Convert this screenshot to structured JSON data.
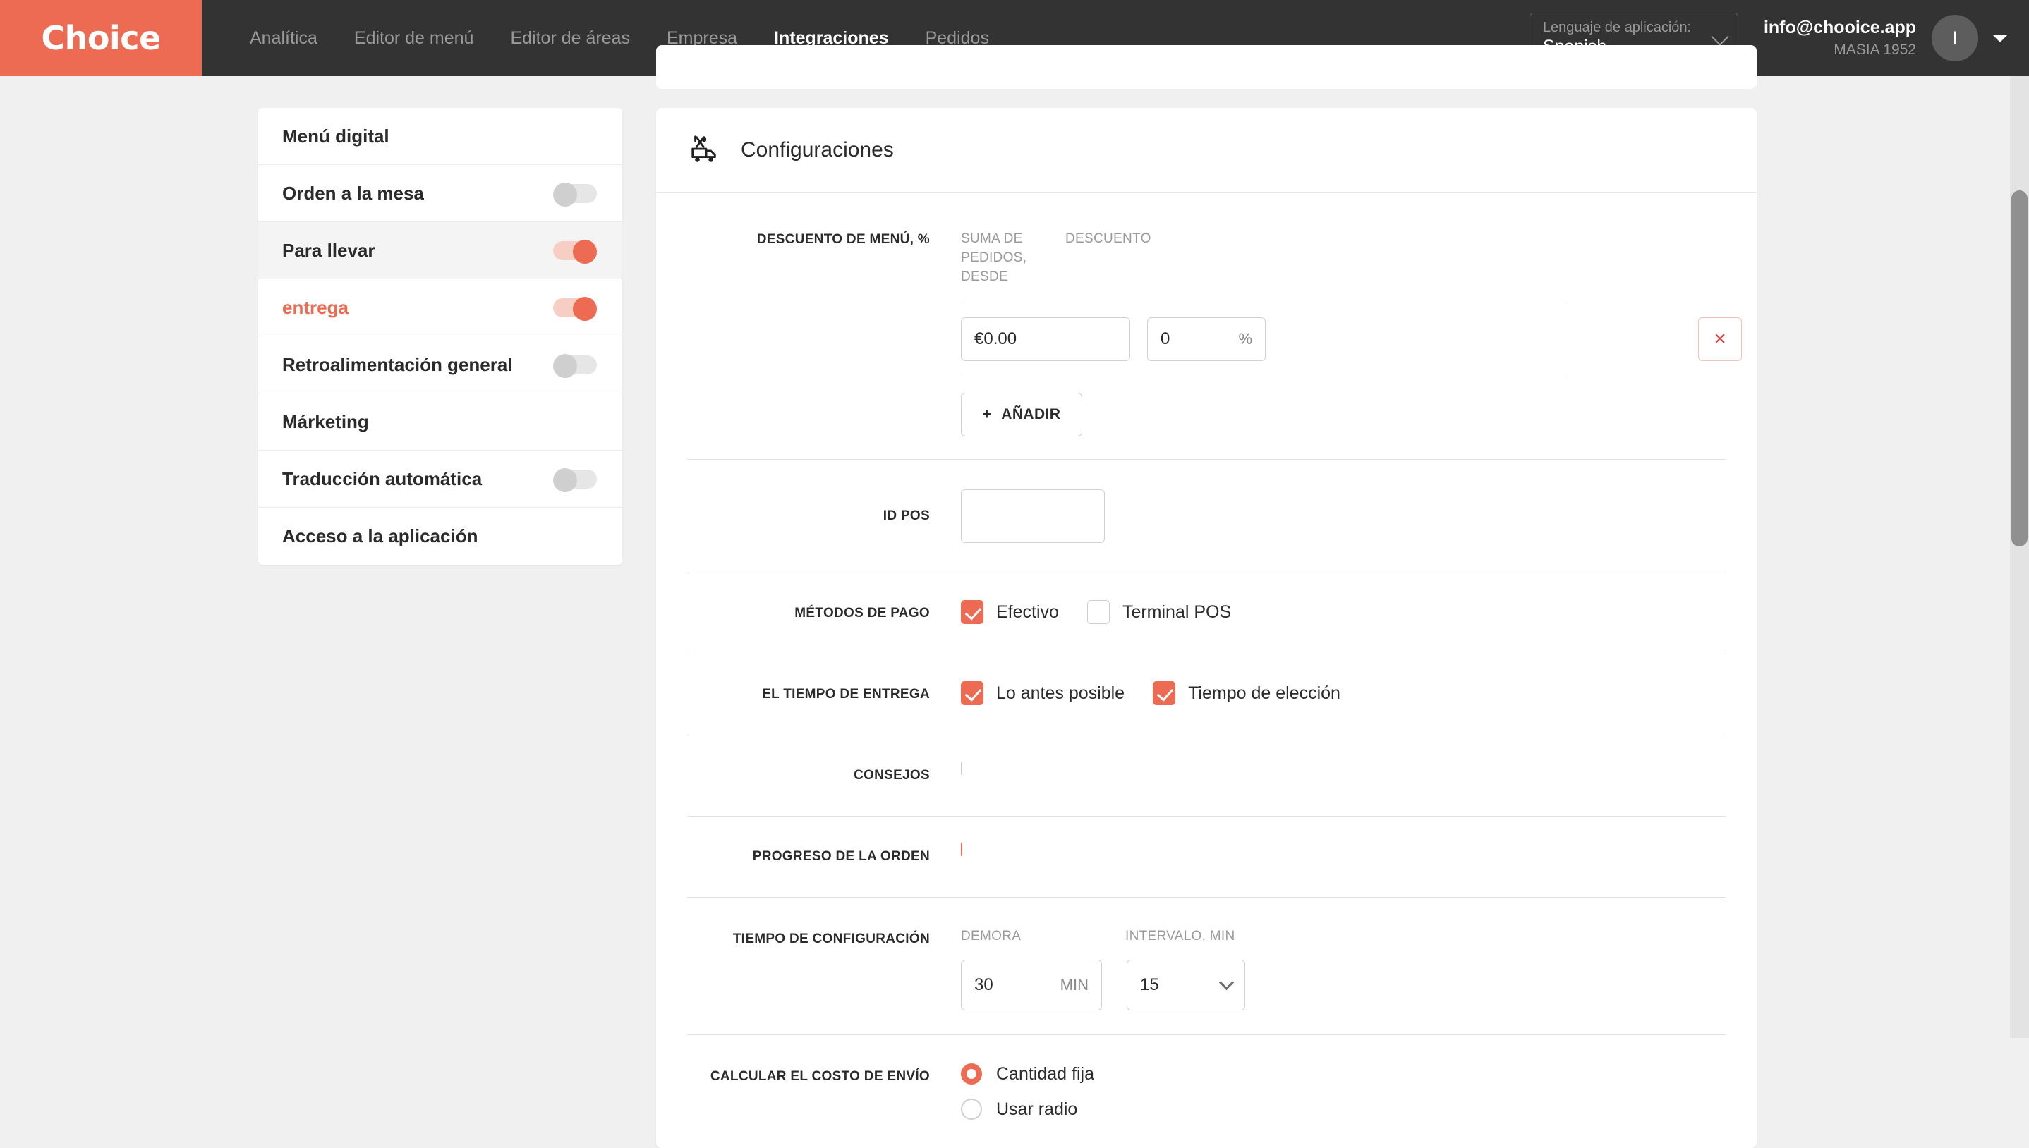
{
  "topnav": {
    "logo": "Choice",
    "items": [
      {
        "label": "Analítica",
        "active": false
      },
      {
        "label": "Editor de menú",
        "active": false
      },
      {
        "label": "Editor de áreas",
        "active": false
      },
      {
        "label": "Empresa",
        "active": false
      },
      {
        "label": "Integraciones",
        "active": true
      },
      {
        "label": "Pedidos",
        "active": false
      }
    ],
    "language": {
      "label": "Lenguaje de aplicación:",
      "value": "Spanish"
    },
    "user": {
      "email": "info@chooice.app",
      "org": "MASIA 1952",
      "avatar_initial": "I"
    }
  },
  "sidebar": {
    "items": [
      {
        "label": "Menú digital",
        "toggle": "none",
        "highlight": false,
        "accent": false
      },
      {
        "label": "Orden a la mesa",
        "toggle": "off",
        "highlight": false,
        "accent": false
      },
      {
        "label": "Para llevar",
        "toggle": "on",
        "highlight": true,
        "accent": false
      },
      {
        "label": "entrega",
        "toggle": "on",
        "highlight": false,
        "accent": true
      },
      {
        "label": "Retroalimentación general",
        "toggle": "off",
        "highlight": false,
        "accent": false
      },
      {
        "label": "Márketing",
        "toggle": "none",
        "highlight": false,
        "accent": false
      },
      {
        "label": "Traducción automática",
        "toggle": "off",
        "highlight": false,
        "accent": false
      },
      {
        "label": "Acceso a la aplicación",
        "toggle": "none",
        "highlight": false,
        "accent": false
      }
    ]
  },
  "card": {
    "title": "Configuraciones",
    "discount": {
      "label": "Descuento de menú, %",
      "col_sum": "Suma de pedidos, desde",
      "col_discount": "Descuento",
      "row_sum_value": "€0.00",
      "row_discount_value": "0",
      "percent_suffix": "%",
      "delete_icon": "×",
      "add_label": "AÑADIR",
      "add_plus": "+"
    },
    "idpos": {
      "label": "ID POS",
      "value": ""
    },
    "payment": {
      "label": "Métodos de pago",
      "options": [
        {
          "label": "Efectivo",
          "checked": true
        },
        {
          "label": "Terminal POS",
          "checked": false
        }
      ]
    },
    "delivery_time": {
      "label": "El tiempo de entrega",
      "options": [
        {
          "label": "Lo antes posible",
          "checked": true
        },
        {
          "label": "Tiempo de elección",
          "checked": true
        }
      ]
    },
    "tips": {
      "label": "Consejos",
      "checked": false
    },
    "order_progress": {
      "label": "Progreso de la orden",
      "checked": true
    },
    "time_config": {
      "label": "Tiempo de configuración",
      "col_delay": "Demora",
      "col_interval": "Intervalo, min",
      "delay_value": "30",
      "delay_suffix": "MIN",
      "interval_value": "15"
    },
    "shipping_cost": {
      "label": "Calcular el costo de envío",
      "options": [
        {
          "label": "Cantidad fija",
          "selected": true
        },
        {
          "label": "Usar radio",
          "selected": false
        }
      ]
    }
  },
  "colors": {
    "accent": "#ec6b52",
    "navbar": "#333333",
    "page_bg": "#f0f0f0",
    "danger": "#d94343"
  }
}
